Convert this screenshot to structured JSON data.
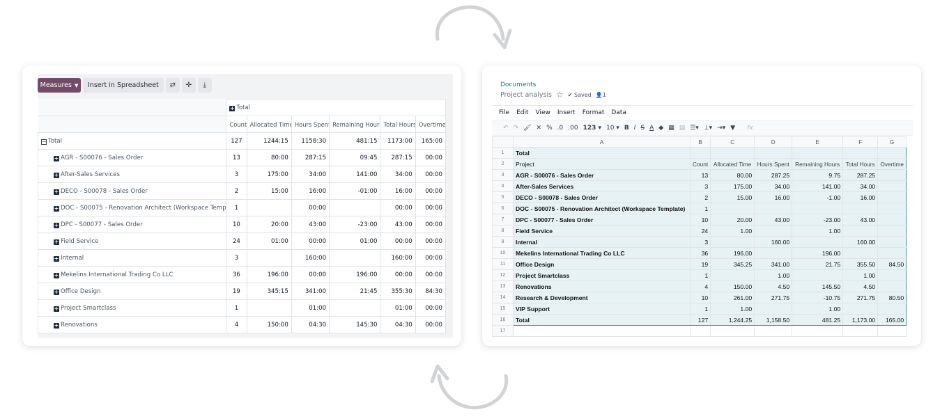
{
  "pivot": {
    "measures_label": "Measures",
    "insert_label": "Insert in Spreadsheet",
    "icons": [
      "flip-axis-icon",
      "expand-icon",
      "download-icon"
    ],
    "total_header": "Total",
    "columns": [
      "Count",
      "Allocated Time",
      "Hours Spent",
      "Remaining Hours",
      "Total Hours",
      "Overtime"
    ],
    "total_row": {
      "label": "Total",
      "values": [
        "127",
        "1244:15",
        "1158:30",
        "481:15",
        "1173:00",
        "165:00"
      ]
    },
    "rows": [
      {
        "label": "AGR - S00076 - Sales Order",
        "values": [
          "13",
          "80:00",
          "287:15",
          "09:45",
          "287:15",
          "00:00"
        ]
      },
      {
        "label": "After-Sales Services",
        "values": [
          "3",
          "175:00",
          "34:00",
          "141:00",
          "34:00",
          "00:00"
        ]
      },
      {
        "label": "DECO - S00078 - Sales Order",
        "values": [
          "2",
          "15:00",
          "16:00",
          "-01:00",
          "16:00",
          "00:00"
        ]
      },
      {
        "label": "DOC - S00075 - Renovation Architect (Workspace Template)",
        "values": [
          "1",
          "",
          "00:00",
          "",
          "00:00",
          "00:00"
        ]
      },
      {
        "label": "DPC - S00077 - Sales Order",
        "values": [
          "10",
          "20:00",
          "43:00",
          "-23:00",
          "43:00",
          "00:00"
        ]
      },
      {
        "label": "Field Service",
        "values": [
          "24",
          "01:00",
          "00:00",
          "01:00",
          "00:00",
          "00:00"
        ]
      },
      {
        "label": "Internal",
        "values": [
          "3",
          "",
          "160:00",
          "",
          "160:00",
          "00:00"
        ]
      },
      {
        "label": "Mekelins International Trading Co LLC",
        "values": [
          "36",
          "196:00",
          "00:00",
          "196:00",
          "00:00",
          "00:00"
        ]
      },
      {
        "label": "Office Design",
        "values": [
          "19",
          "345:15",
          "341:00",
          "21:45",
          "355:30",
          "84:30"
        ]
      },
      {
        "label": "Project Smartclass",
        "values": [
          "1",
          "",
          "01:00",
          "",
          "01:00",
          "00:00"
        ]
      },
      {
        "label": "Renovations",
        "values": [
          "4",
          "150:00",
          "04:30",
          "145:30",
          "04:30",
          "00:00"
        ]
      }
    ]
  },
  "sheet": {
    "breadcrumb": "Documents",
    "title": "Project analysis",
    "saved_label": "Saved",
    "user_count": "1",
    "menu": [
      "File",
      "Edit",
      "View",
      "Insert",
      "Format",
      "Data"
    ],
    "toolbar": {
      "percent": "%",
      "dec_less": ".0",
      "dec_more": ".00",
      "format": "123",
      "font_size": "10",
      "bold": "B",
      "italic": "I",
      "strike": "S",
      "text_color": "A",
      "fx": "fx"
    },
    "col_letters": [
      "A",
      "B",
      "C",
      "D",
      "E",
      "F",
      "G"
    ],
    "row_numbers": [
      "1",
      "2",
      "3",
      "4",
      "5",
      "6",
      "7",
      "8",
      "9",
      "10",
      "11",
      "12",
      "13",
      "14",
      "15",
      "16",
      "17"
    ],
    "total_label": "Total",
    "header_row": [
      "Project",
      "Count",
      "Allocated Time",
      "Hours Spent",
      "Remaining Hours",
      "Total Hours",
      "Overtime"
    ],
    "rows": [
      [
        "AGR - S00076 - Sales Order",
        "13",
        "80.00",
        "287.25",
        "9.75",
        "287.25",
        ""
      ],
      [
        "After-Sales Services",
        "3",
        "175.00",
        "34.00",
        "141.00",
        "34.00",
        ""
      ],
      [
        "DECO - S00078 - Sales Order",
        "2",
        "15.00",
        "16.00",
        "-1.00",
        "16.00",
        ""
      ],
      [
        "DOC - S00075 - Renovation Architect (Workspace Template)",
        "1",
        "",
        "",
        "",
        "",
        ""
      ],
      [
        "DPC - S00077 - Sales Order",
        "10",
        "20.00",
        "43.00",
        "-23.00",
        "43.00",
        ""
      ],
      [
        "Field Service",
        "24",
        "1.00",
        "",
        "1.00",
        "",
        ""
      ],
      [
        "Internal",
        "3",
        "",
        "160.00",
        "",
        "160.00",
        ""
      ],
      [
        "Mekelins International Trading Co LLC",
        "36",
        "196.00",
        "",
        "196.00",
        "",
        ""
      ],
      [
        "Office Design",
        "19",
        "345.25",
        "341.00",
        "21.75",
        "355.50",
        "84.50"
      ],
      [
        "Project Smartclass",
        "1",
        "",
        "1.00",
        "",
        "1.00",
        ""
      ],
      [
        "Renovations",
        "4",
        "150.00",
        "4.50",
        "145.50",
        "4.50",
        ""
      ],
      [
        "Research & Development",
        "10",
        "261.00",
        "271.75",
        "-10.75",
        "271.75",
        "80.50"
      ],
      [
        "VIP Support",
        "1",
        "1.00",
        "",
        "1.00",
        "",
        ""
      ]
    ],
    "total_row": [
      "Total",
      "127",
      "1,244.25",
      "1,158.50",
      "481.25",
      "1,173.00",
      "165.00"
    ]
  },
  "colors": {
    "primary": "#714b67",
    "teal": "#017e84",
    "selection": "#e6f2f3",
    "arrow": "#d1d3d5"
  }
}
